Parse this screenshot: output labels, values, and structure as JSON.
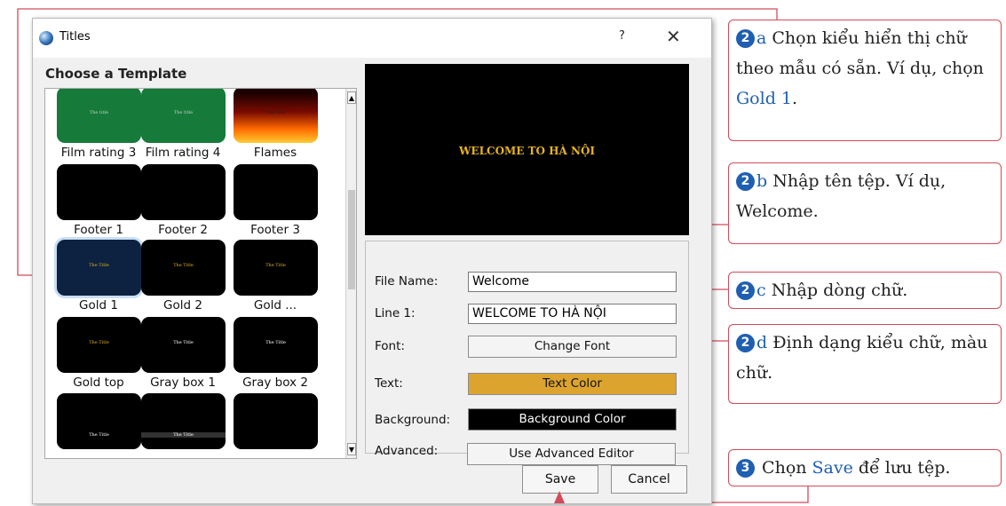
{
  "window": {
    "title": "Titles",
    "help": "?",
    "close": "✕"
  },
  "templates": {
    "heading": "Choose a Template",
    "items": [
      {
        "label": "Film rating 3",
        "thumb": "The title"
      },
      {
        "label": "Film rating 4",
        "thumb": "The title"
      },
      {
        "label": "Flames",
        "thumb": "The Title"
      },
      {
        "label": "Footer 1",
        "thumb": ""
      },
      {
        "label": "Footer 2",
        "thumb": ""
      },
      {
        "label": "Footer 3",
        "thumb": ""
      },
      {
        "label": "Gold 1",
        "thumb": "The Title"
      },
      {
        "label": "Gold 2",
        "thumb": "The Title"
      },
      {
        "label": "Gold ...",
        "thumb": "The Title"
      },
      {
        "label": "Gold top",
        "thumb": "The Title"
      },
      {
        "label": "Gray box 1",
        "thumb": "The Title"
      },
      {
        "label": "Gray box 2",
        "thumb": "The Title"
      },
      {
        "label": "",
        "thumb": "The Title"
      },
      {
        "label": "",
        "thumb": "The Title"
      },
      {
        "label": "",
        "thumb": ""
      }
    ]
  },
  "preview": {
    "text": "WELCOME TO HÀ NỘI"
  },
  "properties": {
    "file_name_label": "File Name:",
    "file_name_value": "Welcome",
    "line1_label": "Line 1:",
    "line1_value": "WELCOME TO HÀ NỘI",
    "font_label": "Font:",
    "font_button": "Change Font",
    "text_label": "Text:",
    "text_button": "Text Color",
    "background_label": "Background:",
    "background_button": "Background Color",
    "advanced_label": "Advanced:",
    "advanced_button": "Use Advanced Editor"
  },
  "buttons": {
    "save": "Save",
    "cancel": "Cancel"
  },
  "annotations": {
    "a": {
      "badge": "2",
      "letter": "a",
      "text_before": " Chọn kiểu hiển thị chữ theo mẫu có sẵn. Ví dụ, chọn ",
      "highlight": "Gold 1",
      "text_after": "."
    },
    "b": {
      "badge": "2",
      "letter": "b",
      "text": " Nhập tên tệp. Ví dụ, Welcome."
    },
    "c": {
      "badge": "2",
      "letter": "c",
      "text": " Nhập dòng chữ."
    },
    "d": {
      "badge": "2",
      "letter": "d",
      "text": " Định dạng kiểu chữ, màu chữ."
    },
    "e": {
      "badge": "3",
      "text_before": " Chọn ",
      "highlight": "Save",
      "text_after": " để lưu tệp."
    }
  },
  "colors": {
    "accent": "#d24b5a",
    "badge": "#1f5fb2",
    "gold": "#dca42f",
    "preview_text": "#e6b422"
  }
}
